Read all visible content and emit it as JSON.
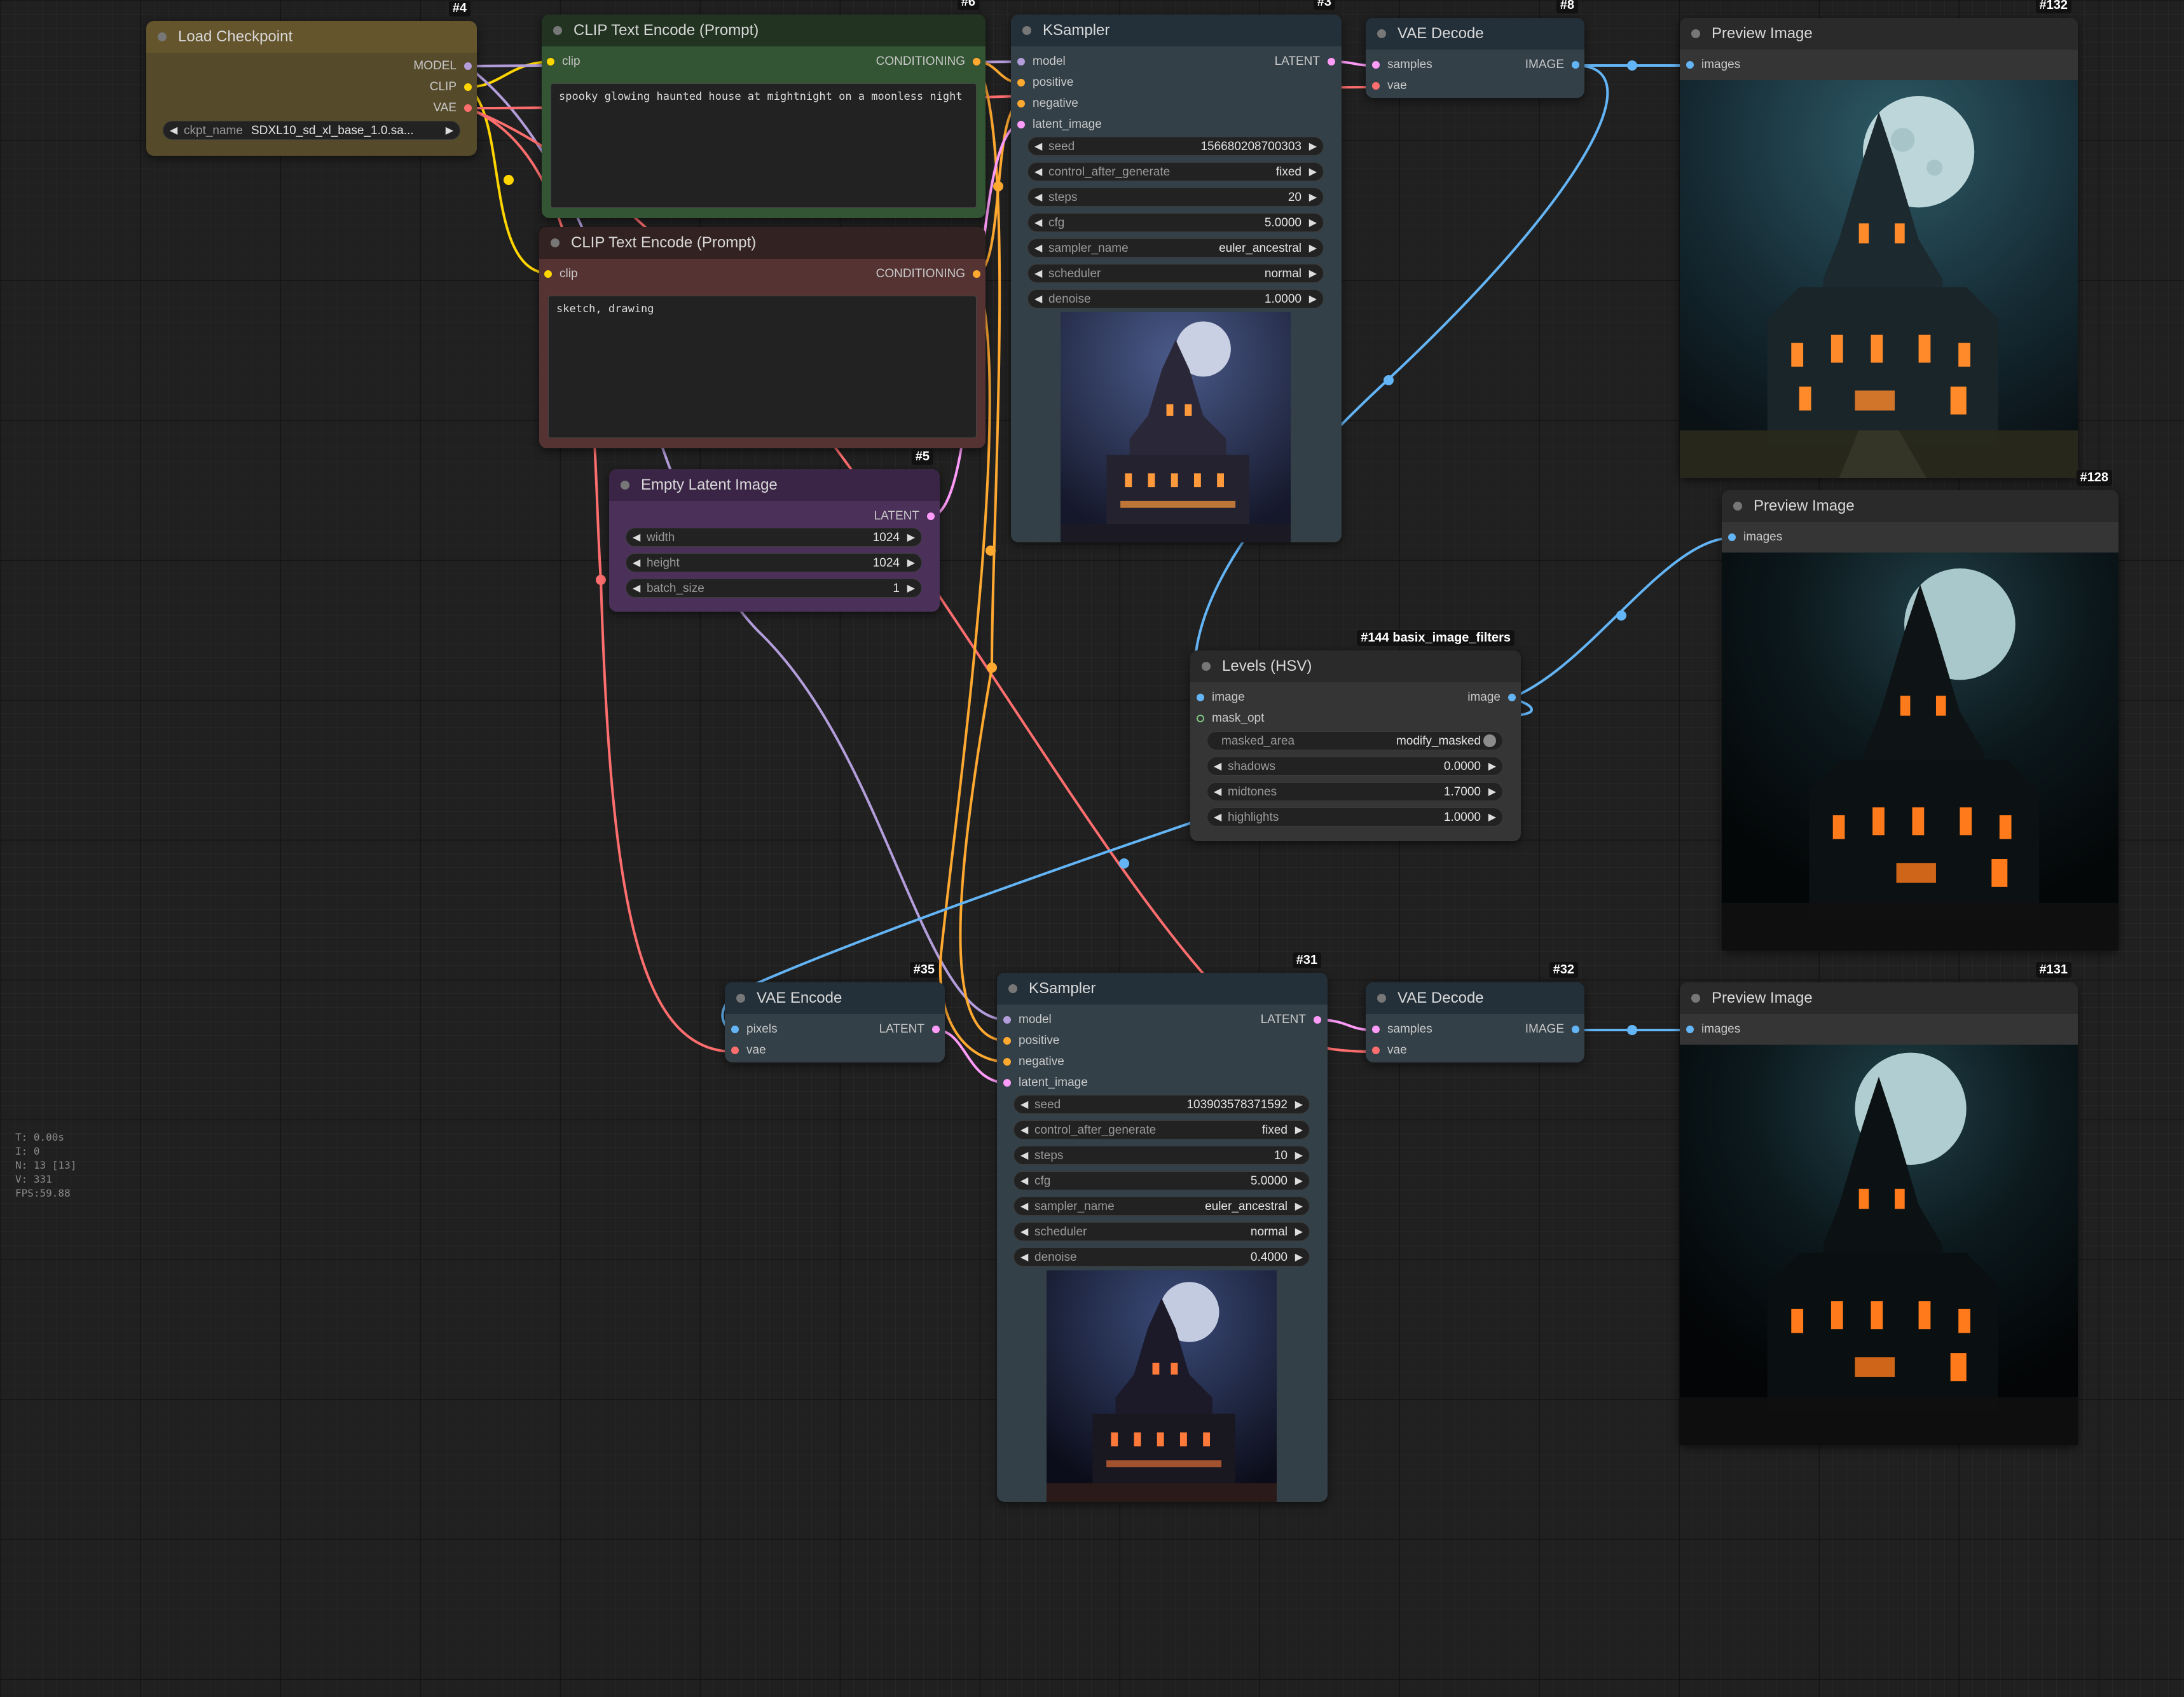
{
  "colors": {
    "model": "#b39ddb",
    "clip": "#ffd500",
    "vae": "#ff6e6e",
    "conditioning": "#ffa931",
    "latent": "#ff9cf9",
    "image": "#64b5f6",
    "mask": "#81c784"
  },
  "nodes": {
    "load_checkpoint": {
      "id": "#4",
      "title": "Load Checkpoint",
      "outputs": [
        "MODEL",
        "CLIP",
        "VAE"
      ],
      "ckpt_label": "ckpt_name",
      "ckpt_value": "SDXL10_sd_xl_base_1.0.sa..."
    },
    "clip_pos": {
      "id": "#6",
      "title": "CLIP Text Encode (Prompt)",
      "input": "clip",
      "output": "CONDITIONING",
      "text": "spooky glowing haunted house at mightnight on a moonless night"
    },
    "clip_neg": {
      "id": "#7",
      "title": "CLIP Text Encode (Prompt)",
      "input": "clip",
      "output": "CONDITIONING",
      "text": "sketch, drawing"
    },
    "empty_latent": {
      "id": "#5",
      "title": "Empty Latent Image",
      "output": "LATENT",
      "widgets": [
        {
          "label": "width",
          "value": "1024"
        },
        {
          "label": "height",
          "value": "1024"
        },
        {
          "label": "batch_size",
          "value": "1"
        }
      ]
    },
    "ksampler1": {
      "id": "#3",
      "title": "KSampler",
      "inputs": [
        "model",
        "positive",
        "negative",
        "latent_image"
      ],
      "output": "LATENT",
      "widgets": [
        {
          "label": "seed",
          "value": "156680208700303"
        },
        {
          "label": "control_after_generate",
          "value": "fixed"
        },
        {
          "label": "steps",
          "value": "20"
        },
        {
          "label": "cfg",
          "value": "5.0000"
        },
        {
          "label": "sampler_name",
          "value": "euler_ancestral"
        },
        {
          "label": "scheduler",
          "value": "normal"
        },
        {
          "label": "denoise",
          "value": "1.0000"
        }
      ]
    },
    "vae_decode1": {
      "id": "#8",
      "title": "VAE Decode",
      "inputs": [
        "samples",
        "vae"
      ],
      "output": "IMAGE"
    },
    "preview132": {
      "id": "#132",
      "title": "Preview Image",
      "input": "images"
    },
    "preview128": {
      "id": "#128",
      "title": "Preview Image",
      "input": "images"
    },
    "levels": {
      "id": "#144 basix_image_filters",
      "title": "Levels (HSV)",
      "inputs": [
        "image",
        "mask_opt"
      ],
      "output": "image",
      "toggle": {
        "label": "masked_area",
        "value": "modify_masked"
      },
      "widgets": [
        {
          "label": "shadows",
          "value": "0.0000"
        },
        {
          "label": "midtones",
          "value": "1.7000"
        },
        {
          "label": "highlights",
          "value": "1.0000"
        }
      ]
    },
    "vae_encode": {
      "id": "#35",
      "title": "VAE Encode",
      "inputs": [
        "pixels",
        "vae"
      ],
      "output": "LATENT"
    },
    "ksampler2": {
      "id": "#31",
      "title": "KSampler",
      "inputs": [
        "model",
        "positive",
        "negative",
        "latent_image"
      ],
      "output": "LATENT",
      "widgets": [
        {
          "label": "seed",
          "value": "103903578371592"
        },
        {
          "label": "control_after_generate",
          "value": "fixed"
        },
        {
          "label": "steps",
          "value": "10"
        },
        {
          "label": "cfg",
          "value": "5.0000"
        },
        {
          "label": "sampler_name",
          "value": "euler_ancestral"
        },
        {
          "label": "scheduler",
          "value": "normal"
        },
        {
          "label": "denoise",
          "value": "0.4000"
        }
      ]
    },
    "vae_decode2": {
      "id": "#32",
      "title": "VAE Decode",
      "inputs": [
        "samples",
        "vae"
      ],
      "output": "IMAGE"
    },
    "preview131": {
      "id": "#131",
      "title": "Preview Image",
      "input": "images"
    }
  },
  "stats": [
    "T: 0.00s",
    "I: 0",
    "N: 13 [13]",
    "V: 331",
    "FPS:59.88"
  ]
}
